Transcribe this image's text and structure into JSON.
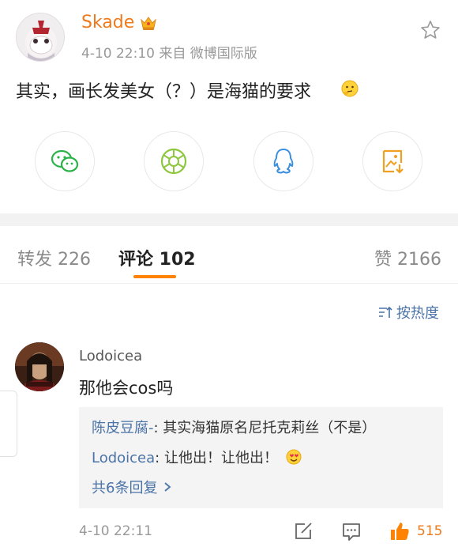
{
  "post": {
    "username": "Skade",
    "meta": "4-10 22:10  来自 微博国际版",
    "text": "其实，画长发美女（？）是海猫的要求"
  },
  "share_buttons": [
    "wechat-icon",
    "moments-icon",
    "qq-icon",
    "save-image-icon"
  ],
  "tabs": {
    "repost": "转发 226",
    "comments": "评论 102",
    "likes": "赞 2166"
  },
  "sort": {
    "label": "按热度"
  },
  "comment": {
    "user": "Lodoicea",
    "text": "那他会cos吗",
    "replies": [
      {
        "name": "陈皮豆腐-",
        "text": ": 其实海猫原名尼托克莉丝（不是）"
      },
      {
        "name": "Lodoicea",
        "text": ": 让他出！让他出！"
      }
    ],
    "more_replies": "共6条回复",
    "time": "4-10 22:11",
    "like_count": "515"
  },
  "colors": {
    "accent_orange": "#ff8200",
    "link_blue": "#4a73a8",
    "wechat_green": "#2bb34a",
    "moments_green": "#8dc63f",
    "qq_blue": "#3a8fe0",
    "save_orange": "#f0a020"
  }
}
